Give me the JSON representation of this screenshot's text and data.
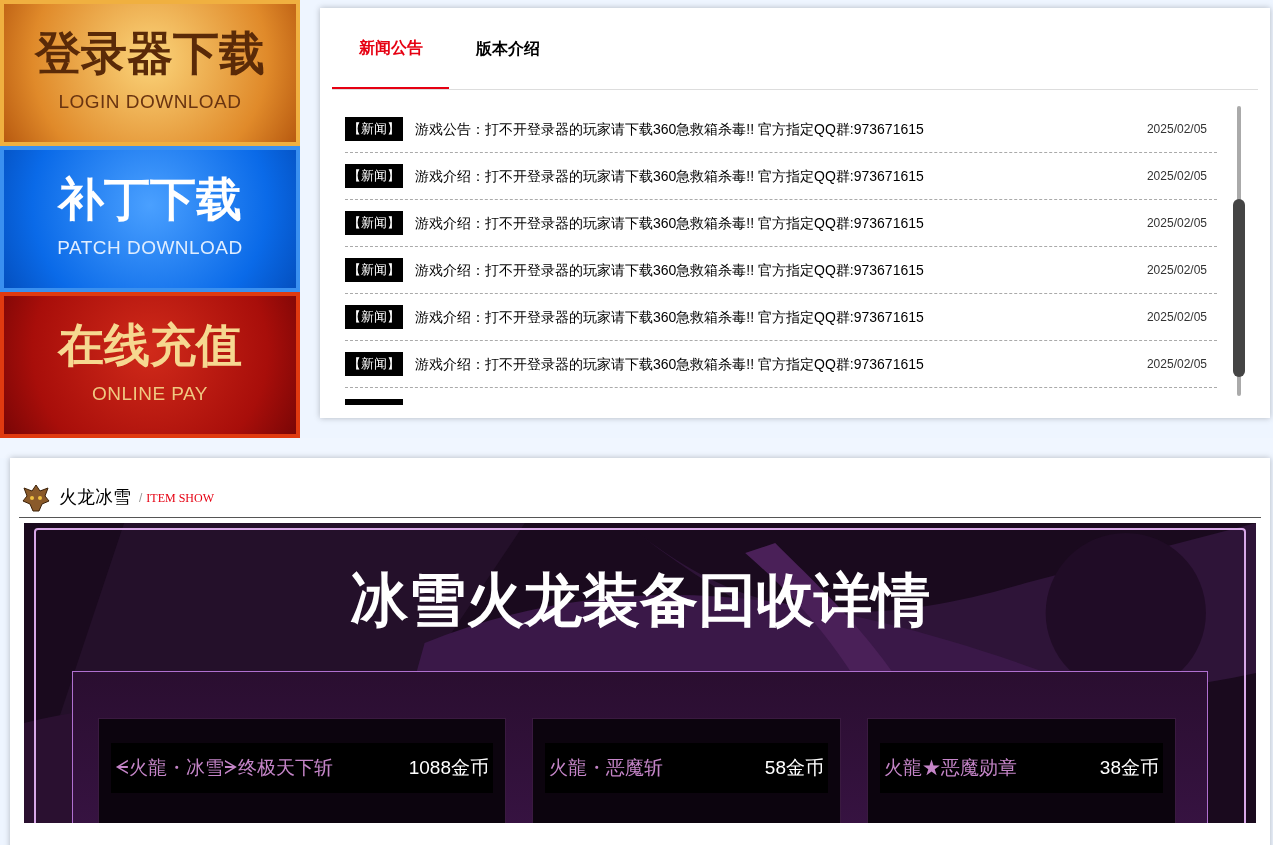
{
  "banners": [
    {
      "kind": "gold",
      "title": "登录器下载",
      "subtitle": "LOGIN DOWNLOAD"
    },
    {
      "kind": "blue",
      "title": "补丁下载",
      "subtitle": "PATCH DOWNLOAD"
    },
    {
      "kind": "red",
      "title": "在线充值",
      "subtitle": "ONLINE PAY"
    }
  ],
  "news_panel": {
    "tabs": [
      {
        "label": "新闻公告",
        "selected": true
      },
      {
        "label": "版本介绍",
        "selected": false
      }
    ],
    "items": [
      {
        "tag": "【新闻】",
        "text": "游戏公告：打不开登录器的玩家请下载360急救箱杀毒!! 官方指定QQ群:973671615",
        "date": "2025/02/05"
      },
      {
        "tag": "【新闻】",
        "text": "游戏介绍：打不开登录器的玩家请下载360急救箱杀毒!! 官方指定QQ群:973671615",
        "date": "2025/02/05"
      },
      {
        "tag": "【新闻】",
        "text": "游戏介绍：打不开登录器的玩家请下载360急救箱杀毒!! 官方指定QQ群:973671615",
        "date": "2025/02/05"
      },
      {
        "tag": "【新闻】",
        "text": "游戏介绍：打不开登录器的玩家请下载360急救箱杀毒!! 官方指定QQ群:973671615",
        "date": "2025/02/05"
      },
      {
        "tag": "【新闻】",
        "text": "游戏介绍：打不开登录器的玩家请下载360急救箱杀毒!! 官方指定QQ群:973671615",
        "date": "2025/02/05"
      },
      {
        "tag": "【新闻】",
        "text": "游戏介绍：打不开登录器的玩家请下载360急救箱杀毒!! 官方指定QQ群:973671615",
        "date": "2025/02/05"
      }
    ]
  },
  "item_show": {
    "title": "火龙冰雪",
    "separator": "/",
    "subtitle": "ITEM SHOW",
    "poster": {
      "title": "冰雪火龙装备回收详情",
      "cards": [
        {
          "items": [
            {
              "name": "ᗕ火龍・冰雪ᗒ终极天下斩",
              "price": "1088金币"
            }
          ]
        },
        {
          "items": [
            {
              "name": "火龍・恶魔斩",
              "price": "58金币"
            }
          ]
        },
        {
          "items": [
            {
              "name": "火龍★恶魔勋章",
              "price": "38金币"
            }
          ]
        }
      ]
    }
  }
}
